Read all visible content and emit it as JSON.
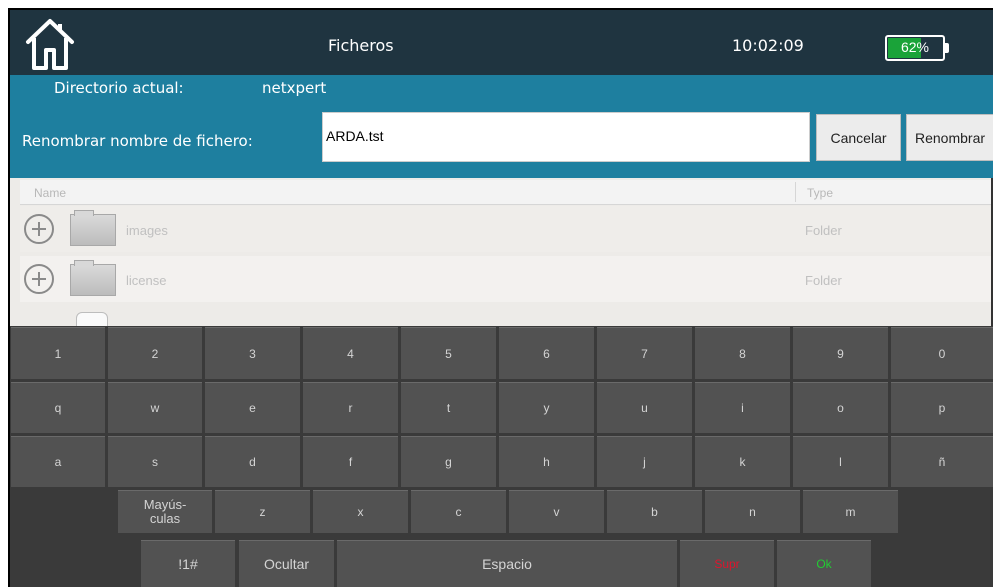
{
  "header": {
    "title": "Ficheros",
    "time": "10:02:09",
    "battery_percent": 62,
    "battery_label": "62%",
    "home_icon": "home-icon",
    "battery_color": "#1aa339"
  },
  "directory": {
    "label": "Directorio actual:",
    "value": "netxpert"
  },
  "rename": {
    "label": "Renombrar nombre de fichero:",
    "input_value": "ARDA.tst",
    "cancel_label": "Cancelar",
    "rename_label": "Renombrar"
  },
  "file_list": {
    "columns": [
      "Name",
      "Type"
    ],
    "rows": [
      {
        "name": "images",
        "type": "Folder"
      },
      {
        "name": "license",
        "type": "Folder"
      }
    ]
  },
  "keyboard": {
    "row1": [
      "1",
      "2",
      "3",
      "4",
      "5",
      "6",
      "7",
      "8",
      "9",
      "0"
    ],
    "row2": [
      "q",
      "w",
      "e",
      "r",
      "t",
      "y",
      "u",
      "i",
      "o",
      "p"
    ],
    "row3": [
      "a",
      "s",
      "d",
      "f",
      "g",
      "h",
      "j",
      "k",
      "l",
      "ñ"
    ],
    "row4": [
      "Mayús-\nculas",
      "z",
      "x",
      "c",
      "v",
      "b",
      "n",
      "m"
    ],
    "row5": [
      "!1#",
      "Ocultar",
      "Espacio",
      "Supr",
      "Ok"
    ]
  },
  "colors": {
    "topbar": "#1f3440",
    "panel": "#1e7f9f",
    "keyboard": "#3a3a3a",
    "key": "#525252",
    "supr": "#e0142c",
    "ok": "#22cc33"
  }
}
